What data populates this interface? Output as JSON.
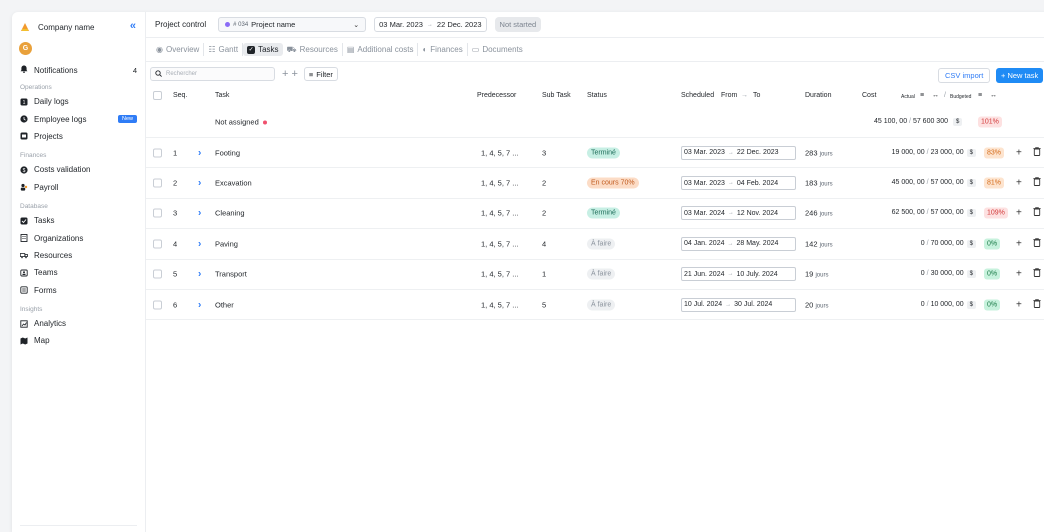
{
  "sidebar": {
    "company_name": "Company name",
    "avatar_initial": "G",
    "notifications": {
      "label": "Notifications",
      "count": "4"
    },
    "sections": [
      {
        "title": "Operations",
        "items": [
          {
            "label": "Daily logs",
            "icon": "calendar-icon"
          },
          {
            "label": "Employee logs",
            "icon": "clock-icon",
            "badge": "New"
          },
          {
            "label": "Projects",
            "icon": "folder-icon"
          }
        ]
      },
      {
        "title": "Finances",
        "items": [
          {
            "label": "Costs validation",
            "icon": "coin-icon"
          },
          {
            "label": "Payroll",
            "icon": "people-icon"
          }
        ]
      },
      {
        "title": "Database",
        "items": [
          {
            "label": "Tasks",
            "icon": "checkbox-icon"
          },
          {
            "label": "Organizations",
            "icon": "building-icon"
          },
          {
            "label": "Resources",
            "icon": "truck-icon"
          },
          {
            "label": "Teams",
            "icon": "team-icon"
          },
          {
            "label": "Forms",
            "icon": "form-icon"
          }
        ]
      },
      {
        "title": "Insights",
        "items": [
          {
            "label": "Analytics",
            "icon": "analytics-icon"
          },
          {
            "label": "Map",
            "icon": "map-icon"
          }
        ]
      }
    ]
  },
  "topbar": {
    "title": "Project control",
    "project_number": "# 034",
    "project_name": "Project name",
    "date_from": "03 Mar. 2023",
    "date_to": "22 Dec. 2023",
    "status": "Not started"
  },
  "tabs": [
    "Overview",
    "Gantt",
    "Tasks",
    "Resources",
    "Additional costs",
    "Finances",
    "Documents"
  ],
  "toolbar": {
    "search_placeholder": "Rechercher",
    "filter_label": "Filter",
    "csv_label": "CSV import",
    "new_task_label": "+ New task"
  },
  "table": {
    "headers": {
      "seq": "Seq.",
      "task": "Task",
      "predecessor": "Predecessor",
      "subtask": "Sub Task",
      "status": "Status",
      "scheduled": "Scheduled",
      "from": "From",
      "to": "To",
      "duration": "Duration",
      "cost": "Cost",
      "actual": "Actual",
      "budgeted": "Budgeted"
    },
    "not_assigned": {
      "label": "Not assigned",
      "actual": "45 100, 00",
      "budgeted": "57 600 300",
      "currency": "$",
      "pct": "101%"
    },
    "rows": [
      {
        "seq": "1",
        "task": "Footing",
        "pred": "1, 4, 5, 7 ...",
        "sub": "3",
        "status": "Terminé",
        "status_kind": "done",
        "from": "03 Mar. 2023",
        "to": "22 Dec. 2023",
        "dur": "283",
        "unit": "jours",
        "actual": "19 000, 00",
        "budgeted": "23 000, 00",
        "cur": "$",
        "pct": "83%",
        "pct_kind": "orange"
      },
      {
        "seq": "2",
        "task": "Excavation",
        "pred": "1, 4, 5, 7 ...",
        "sub": "2",
        "status": "En cours  70%",
        "status_kind": "progress",
        "from": "03 Mar. 2023",
        "to": "04 Feb. 2024",
        "dur": "183",
        "unit": "jours",
        "actual": "45 000, 00",
        "budgeted": "57 000, 00",
        "cur": "$",
        "pct": "81%",
        "pct_kind": "orange"
      },
      {
        "seq": "3",
        "task": "Cleaning",
        "pred": "1, 4, 5, 7 ...",
        "sub": "2",
        "status": "Terminé",
        "status_kind": "done",
        "from": "03 Mar. 2024",
        "to": "12 Nov. 2024",
        "dur": "246",
        "unit": "jours",
        "actual": "62 500, 00",
        "budgeted": "57 000, 00",
        "cur": "$",
        "pct": "109%",
        "pct_kind": "red"
      },
      {
        "seq": "4",
        "task": "Paving",
        "pred": "1, 4, 5, 7 ...",
        "sub": "4",
        "status": "À faire",
        "status_kind": "todo",
        "from": "04 Jan. 2024",
        "to": "28 May. 2024",
        "dur": "142",
        "unit": "jours",
        "actual": "0",
        "budgeted": "70 000, 00",
        "cur": "$",
        "pct": "0%",
        "pct_kind": "green"
      },
      {
        "seq": "5",
        "task": "Transport",
        "pred": "1, 4, 5, 7 ...",
        "sub": "1",
        "status": "À faire",
        "status_kind": "todo",
        "from": "21 Jun. 2024",
        "to": "10 July. 2024",
        "dur": "19",
        "unit": "jours",
        "actual": "0",
        "budgeted": "30 000, 00",
        "cur": "$",
        "pct": "0%",
        "pct_kind": "green"
      },
      {
        "seq": "6",
        "task": "Other",
        "pred": "1, 4, 5, 7 ...",
        "sub": "5",
        "status": "À faire",
        "status_kind": "todo",
        "from": "10 Jul. 2024",
        "to": "30 Jul. 2024",
        "dur": "20",
        "unit": "jours",
        "actual": "0",
        "budgeted": "10 000, 00",
        "cur": "$",
        "pct": "0%",
        "pct_kind": "green"
      }
    ]
  }
}
